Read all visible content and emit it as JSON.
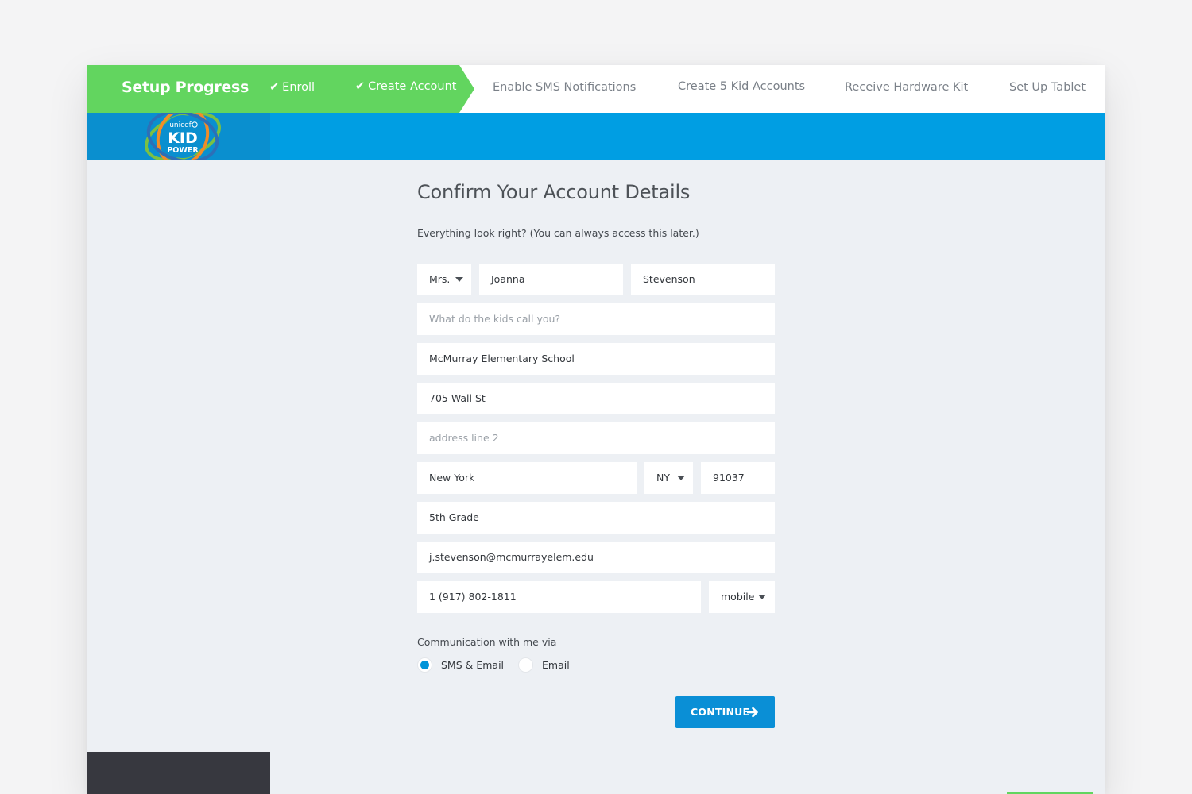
{
  "progress": {
    "title": "Setup Progress",
    "steps": [
      {
        "label": "Enroll",
        "done": true
      },
      {
        "label": "Create Account",
        "done": true
      },
      {
        "label": "Enable SMS Notifications",
        "done": false
      },
      {
        "label": "Create 5 Kid Accounts",
        "done": false
      },
      {
        "label": "Receive Hardware Kit",
        "done": false
      },
      {
        "label": "Set Up Tablet",
        "done": false
      }
    ],
    "check_icon": "check-icon"
  },
  "logo": {
    "line1": "unicef",
    "line2": "KID",
    "line3": "POWER"
  },
  "form": {
    "title": "Confirm Your Account Details",
    "subtitle": "Everything look right? (You can always access this later.)",
    "salutation": "Mrs.",
    "first_name": "Joanna",
    "last_name": "Stevenson",
    "nickname_placeholder": "What do the kids call you?",
    "school": "McMurray Elementary School",
    "address1": "705 Wall St",
    "address2_placeholder": "address line 2",
    "city": "New York",
    "state": "NY",
    "zip": "91037",
    "grade": "5th Grade",
    "email": "j.stevenson@mcmurrayelem.edu",
    "phone": "1 (917) 802-1811",
    "phone_type": "mobile",
    "communication_label": "Communication with me via",
    "option_sms_email": "SMS & Email",
    "option_email": "Email",
    "selected_option": "SMS & Email",
    "continue_label": "CONTINUE"
  },
  "colors": {
    "green": "#62d55f",
    "blue": "#009ee3",
    "button_blue": "#0a8fd6",
    "footer_dark": "#37383f"
  }
}
